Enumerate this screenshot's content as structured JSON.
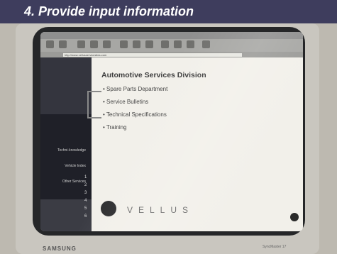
{
  "header": {
    "title": "4. Provide input information"
  },
  "browser": {
    "address": "http://www.vellusservicesites.com"
  },
  "sidebar": {
    "items": [
      "Techni-knowledge",
      "Vehicle Index",
      "Other Services"
    ],
    "numbers": [
      "1",
      "2",
      "3",
      "4",
      "5",
      "6"
    ]
  },
  "content": {
    "title": "Automotive Services Division",
    "links": [
      "Spare Parts Department",
      "Service Bulletins",
      "Technical Specifications",
      "Training"
    ],
    "logo_text": "VELLUS"
  },
  "monitor": {
    "brand": "SAMSUNG",
    "model": "SyncMaster 17"
  }
}
